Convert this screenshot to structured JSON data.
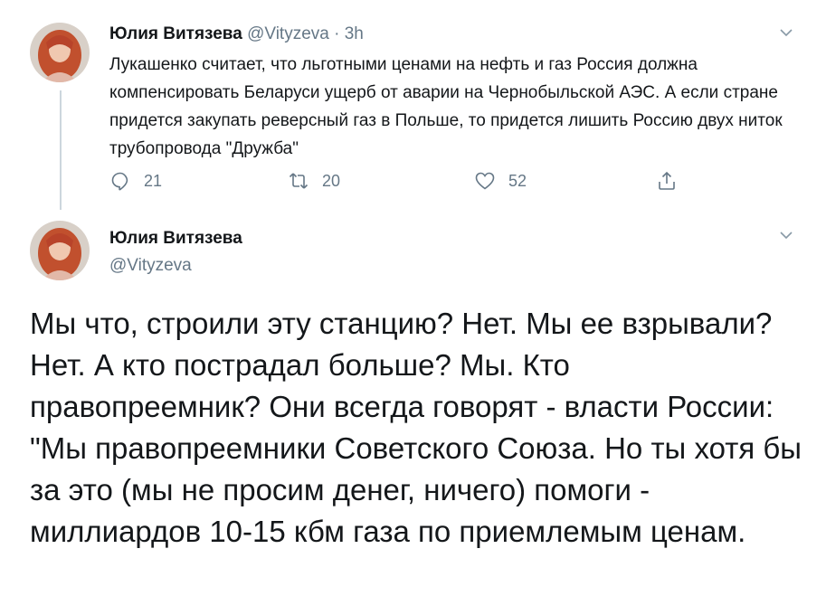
{
  "tweet1": {
    "author_name": "Юлия Витязева",
    "handle": "@Vityzeva",
    "time_sep": " · ",
    "time": "3h",
    "text": "Лукашенко считает, что льготными ценами на нефть и газ Россия должна компенсировать Беларуси ущерб от аварии на Чернобыльской АЭС. А если стране придется закупать реверсный газ в Польше, то придется лишить Россию двух ниток трубопровода \"Дружба\"",
    "reply_count": "21",
    "retweet_count": "20",
    "like_count": "52"
  },
  "tweet2": {
    "author_name": "Юлия Витязева",
    "handle": "@Vityzeva",
    "text": "Мы что, строили эту станцию? Нет. Мы ее взрывали? Нет. А кто пострадал больше? Мы. Кто правопреемник? Они всегда говорят - власти России: \"Мы правопреемники Советского Союза. Но ты хотя бы за это (мы не просим денег, ничего) помоги - миллиардов 10-15 кбм газа по приемлемым ценам."
  },
  "icons": {
    "reply": "reply-icon",
    "retweet": "retweet-icon",
    "like": "heart-icon",
    "share": "share-icon",
    "menu": "chevron-down-icon"
  },
  "colors": {
    "text": "#14171a",
    "secondary": "#657786",
    "thread_line": "#ccd6dd"
  }
}
